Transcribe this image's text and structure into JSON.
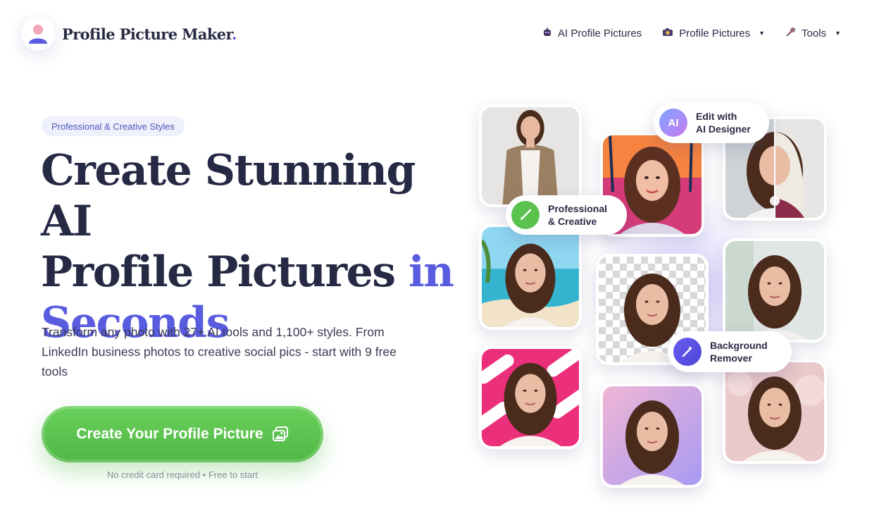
{
  "brand": {
    "name": "Profile Picture Maker",
    "dot": "."
  },
  "nav": {
    "items": [
      {
        "label": "AI Profile Pictures",
        "icon": "robot-icon",
        "has_dropdown": false
      },
      {
        "label": "Profile Pictures",
        "icon": "camera-icon",
        "has_dropdown": true
      },
      {
        "label": "Tools",
        "icon": "tools-icon",
        "has_dropdown": true
      }
    ]
  },
  "hero": {
    "pill": "Professional & Creative Styles",
    "title_line1": "Create Stunning AI",
    "title_line2_plain": "Profile Pictures ",
    "title_line2_accent": "in",
    "title_line3_accent": "Seconds",
    "description": "Transform any photo with 27+ AI tools and 1,100+ styles. From LinkedIn business photos to creative social pics - start with 9 free tools",
    "cta_label": "Create Your Profile Picture",
    "cta_note": "No credit card required • Free to start"
  },
  "badges": {
    "ai_designer": {
      "icon_text": "AI",
      "line1": "Edit with",
      "line2": "AI Designer"
    },
    "professional": {
      "line1": "Professional",
      "line2": "& Creative"
    },
    "bg_remover": {
      "line1": "Background",
      "line2": "Remover"
    }
  },
  "colors": {
    "accent": "#5a5ce0",
    "cta_green": "#5bc24e",
    "text_dark": "#262944",
    "pill_bg": "#eef0fb"
  }
}
